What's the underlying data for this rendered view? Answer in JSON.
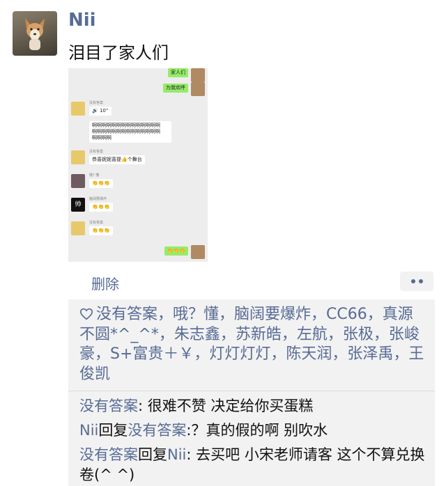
{
  "post": {
    "author": "Nii",
    "text": "泪目了家人们",
    "delete_label": "删除"
  },
  "screenshot": {
    "messages": [
      {
        "side": "right",
        "text": "家人们"
      },
      {
        "side": "right",
        "text": "为我欢呼"
      },
      {
        "side": "left",
        "sender": "没有答案",
        "text": "🔊 10''"
      },
      {
        "side": "left",
        "text": "啊啊啊啊啊啊啊啊啊啊啊啊啊啊"
      },
      {
        "side": "left",
        "text": "啊啊啊啊啊啊啊啊啊啊啊啊啊啊"
      },
      {
        "side": "left",
        "text": "啊啊啊啊"
      },
      {
        "side": "left",
        "sender": "没有答案",
        "text": "恭喜妮妮喜提👍个舞台"
      },
      {
        "side": "left",
        "sender": "哦? 懂",
        "text": "👏👏👏"
      },
      {
        "side": "left",
        "sender": "脑阔要爆炸",
        "avatar_text": "帅",
        "text": "👏👏👏"
      },
      {
        "side": "left",
        "sender": "没有答案",
        "text": "👏👏👏"
      },
      {
        "side": "right",
        "text": "👏👏👏"
      }
    ]
  },
  "likes": {
    "icon": "heart-outline-icon",
    "text": "没有答案，哦？懂，脑阔要爆炸，CC66，真源不圆*^_^*，朱志鑫，苏新皓，左航，张极，张峻豪，S+富贵＋￥，灯灯灯灯，陈天润，张泽禹，王俊凯"
  },
  "comments": [
    {
      "user": "没有答案",
      "reply_word": "",
      "reply_to": "",
      "text": ": 很难不赞 决定给你买蛋糕"
    },
    {
      "user": "Nii",
      "reply_word": "回复",
      "reply_to": "没有答案",
      "text": ":？真的假的啊 别吹水"
    },
    {
      "user": "没有答案",
      "reply_word": "回复",
      "reply_to": "Nii",
      "text": ": 去买吧 小宋老师请客 这个不算兑换卷(^ ^)"
    }
  ],
  "colors": {
    "link": "#576b95",
    "panel": "#f2f2f2",
    "green_bubble": "#95ec69"
  }
}
